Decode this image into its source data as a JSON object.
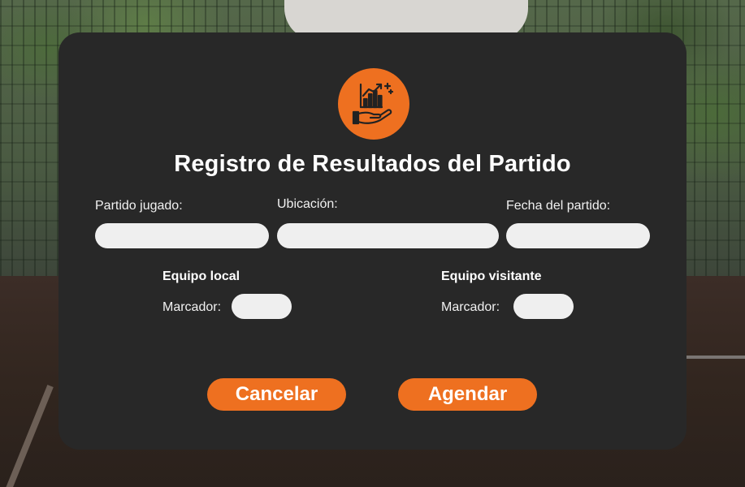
{
  "colors": {
    "accent": "#ee7020",
    "panel": "#282828",
    "field": "#efefef"
  },
  "header": {
    "logo_icon": "growth-chart-hand-icon",
    "title": "Registro de Resultados del Partido"
  },
  "form": {
    "partido": {
      "label": "Partido jugado:",
      "value": ""
    },
    "ubicacion": {
      "label": "Ubicación:",
      "value": ""
    },
    "fecha": {
      "label": "Fecha del partido:",
      "value": ""
    },
    "local": {
      "title": "Equipo local",
      "score_label": "Marcador:",
      "score_value": ""
    },
    "visitante": {
      "title": "Equipo visitante",
      "score_label": "Marcador:",
      "score_value": ""
    }
  },
  "actions": {
    "cancel": "Cancelar",
    "submit": "Agendar"
  }
}
